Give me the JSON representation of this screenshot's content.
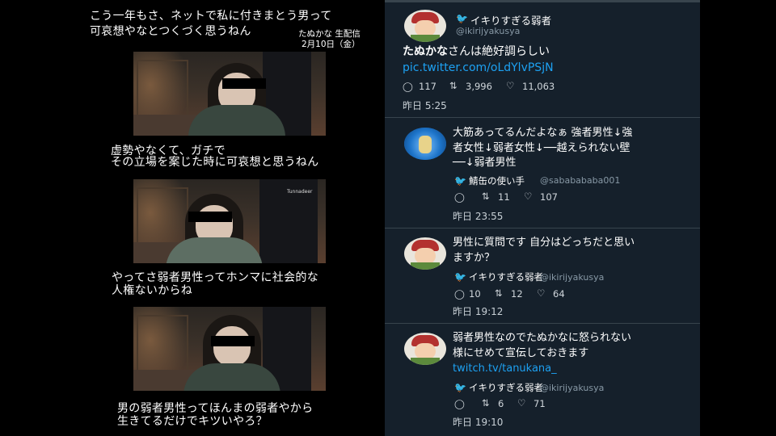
{
  "left_panel": {
    "top_caption_line1": "こう一年もさ、ネットで私に付きまとう男って",
    "top_caption_line2": "可哀想やなとつくづく思うねん",
    "stamp_line1": "たぬかな 生配信",
    "stamp_line2": "2月10日（金）",
    "caption2_line1": "虚勢やなくて、ガチで",
    "caption2_line2": "その立場を案じた時に可哀想と思うねん",
    "caption3_line1": "やってさ弱者男性ってホンマに社会的な",
    "caption3_line2": "人権ないからね",
    "caption4_line1": "男の弱者男性ってほんまの弱者やから",
    "caption4_line2": "生きてるだけでキツいやろ？",
    "frame2_logo": "Tunnadeer"
  },
  "tweets": [
    {
      "name": "イキりすぎる弱者",
      "handle": "@ikirijyakusya",
      "text_bold": "たぬかな",
      "text_rest": "さんは絶好調らしい",
      "link": "pic.twitter.com/oLdYlvPSjN",
      "replies": "117",
      "retweets": "3,996",
      "likes": "11,063",
      "time": "昨日 5:25"
    },
    {
      "line1": "大筋あってるんだよなぁ 強者男性↓強",
      "line2": "者女性↓弱者女性↓──越えられない壁",
      "line3": "──↓弱者男性",
      "quoted_name": "鯖缶の使い手",
      "quoted_handle": "@sababababa001",
      "replies": "",
      "retweets": "11",
      "likes": "107",
      "time": "昨日 23:55"
    },
    {
      "line1": "男性に質問です 自分はどっちだと思い",
      "line2": "ますか？",
      "quoted_name": "イキりすぎる弱者",
      "quoted_handle": "@ikirijyakusya",
      "replies": "10",
      "retweets": "12",
      "likes": "64",
      "time": "昨日 19:12"
    },
    {
      "line1": "弱者男性なのでたぬかなに怒られない",
      "line2": "様にせめて宣伝しておきます",
      "link": "twitch.tv/tanukana_",
      "quoted_name": "イキりすぎる弱者",
      "quoted_handle": "@ikirijyakusya",
      "replies": "",
      "retweets": "6",
      "likes": "71",
      "time": "昨日 19:10"
    }
  ],
  "colors": {
    "twitter_bg": "#15202b",
    "link": "#1da1f2",
    "secondary": "#8899a6",
    "separator": "#38444d"
  }
}
